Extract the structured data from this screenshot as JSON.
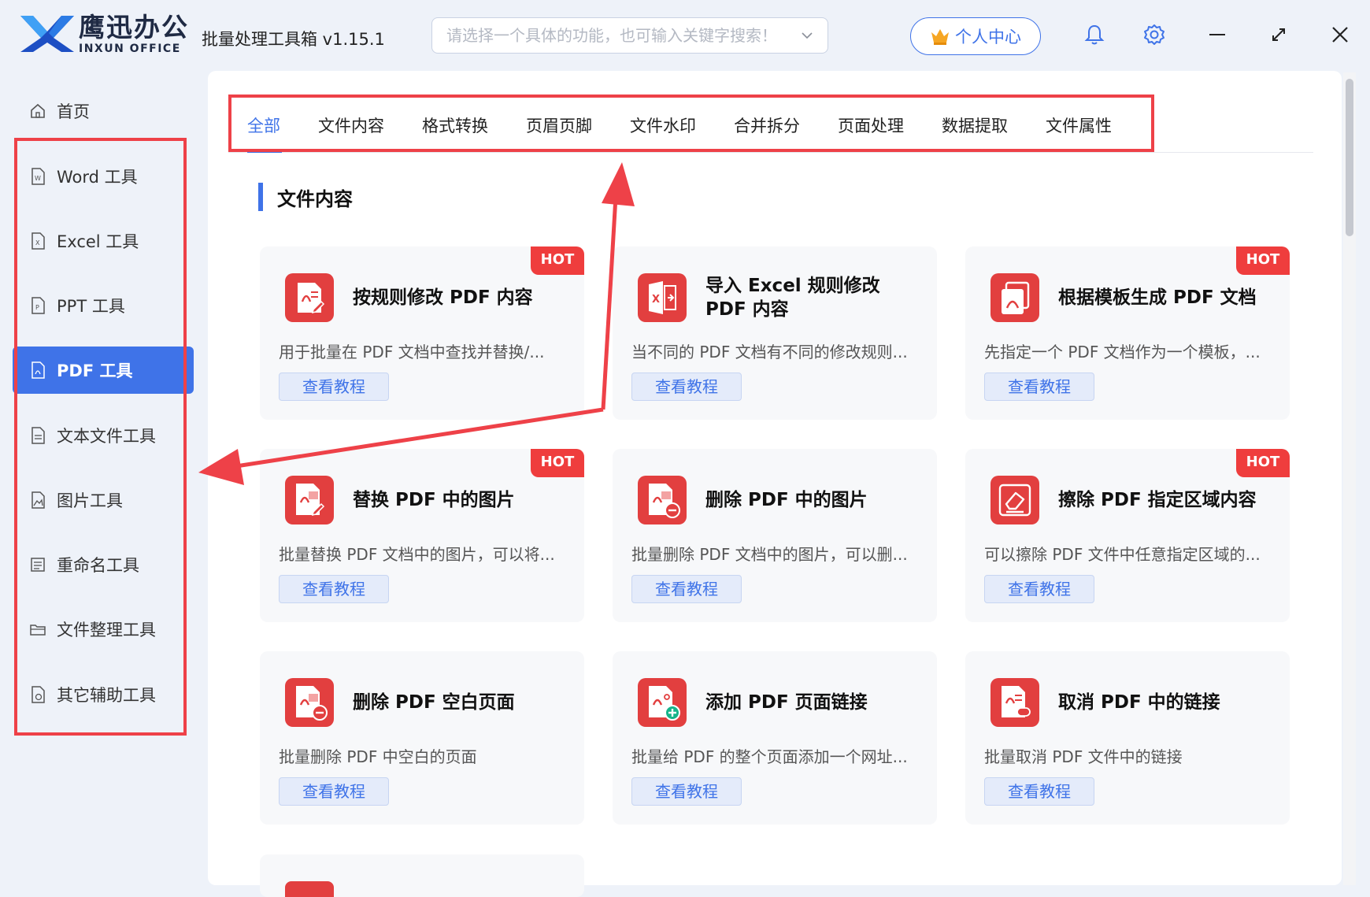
{
  "brand": {
    "cn": "鹰迅办公",
    "en": "INXUN OFFICE",
    "app_title": "批量处理工具箱 v1.15.1"
  },
  "search": {
    "placeholder": "请选择一个具体的功能，也可输入关键字搜索！",
    "value": ""
  },
  "header": {
    "user_center": "个人中心"
  },
  "sidebar": {
    "items": [
      {
        "label": "首页",
        "icon": "home-icon"
      },
      {
        "label": "Word 工具",
        "icon": "word-file-icon"
      },
      {
        "label": "Excel 工具",
        "icon": "excel-file-icon"
      },
      {
        "label": "PPT 工具",
        "icon": "ppt-file-icon"
      },
      {
        "label": "PDF 工具",
        "icon": "pdf-file-icon",
        "active": true
      },
      {
        "label": "文本文件工具",
        "icon": "text-file-icon"
      },
      {
        "label": "图片工具",
        "icon": "image-file-icon"
      },
      {
        "label": "重命名工具",
        "icon": "rename-icon"
      },
      {
        "label": "文件整理工具",
        "icon": "folder-icon"
      },
      {
        "label": "其它辅助工具",
        "icon": "misc-tools-icon"
      }
    ]
  },
  "tabs": [
    {
      "label": "全部",
      "active": true
    },
    {
      "label": "文件内容"
    },
    {
      "label": "格式转换"
    },
    {
      "label": "页眉页脚"
    },
    {
      "label": "文件水印"
    },
    {
      "label": "合并拆分"
    },
    {
      "label": "页面处理"
    },
    {
      "label": "数据提取"
    },
    {
      "label": "文件属性"
    }
  ],
  "section": {
    "title": "文件内容"
  },
  "cards": [
    {
      "title": "按规则修改 PDF 内容",
      "desc": "用于批量在 PDF 文档中查找并替换/...",
      "button": "查看教程",
      "hot": "HOT",
      "icon": "pdf-edit-icon"
    },
    {
      "title": "导入 Excel 规则修改 PDF 内容",
      "desc": "当不同的 PDF 文档有不同的修改规则...",
      "button": "查看教程",
      "hot": "",
      "icon": "excel-import-icon"
    },
    {
      "title": "根据模板生成 PDF 文档",
      "desc": "先指定一个 PDF 文档作为一个模板，...",
      "button": "查看教程",
      "hot": "HOT",
      "icon": "pdf-template-icon"
    },
    {
      "title": "替换 PDF 中的图片",
      "desc": "批量替换 PDF 文档中的图片，可以将...",
      "button": "查看教程",
      "hot": "HOT",
      "icon": "pdf-image-replace-icon"
    },
    {
      "title": "删除 PDF 中的图片",
      "desc": "批量删除 PDF 文档中的图片，可以删...",
      "button": "查看教程",
      "hot": "",
      "icon": "pdf-image-delete-icon"
    },
    {
      "title": "擦除 PDF 指定区域内容",
      "desc": "可以擦除 PDF 文件中任意指定区域的...",
      "button": "查看教程",
      "hot": "HOT",
      "icon": "eraser-icon"
    },
    {
      "title": "删除 PDF 空白页面",
      "desc": "批量删除 PDF 中空白的页面",
      "button": "查看教程",
      "hot": "",
      "icon": "pdf-blank-delete-icon"
    },
    {
      "title": "添加 PDF 页面链接",
      "desc": "批量给 PDF 的整个页面添加一个网址...",
      "button": "查看教程",
      "hot": "",
      "icon": "pdf-link-add-icon"
    },
    {
      "title": "取消 PDF 中的链接",
      "desc": "批量取消 PDF 文件中的链接",
      "button": "查看教程",
      "hot": "",
      "icon": "pdf-link-remove-icon"
    }
  ],
  "colors": {
    "accent": "#3f73e8",
    "hot": "#ef3d3d",
    "icon_red": "#e23f3f",
    "annotation": "#ee4148"
  }
}
